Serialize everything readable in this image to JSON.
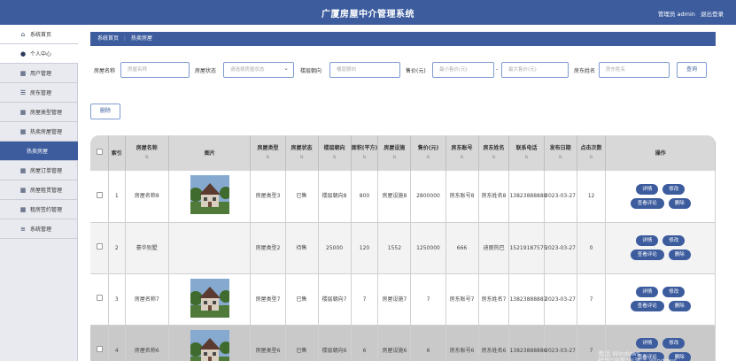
{
  "header": {
    "title": "广厦房屋中介管理系统",
    "user_label": "管理员 admin",
    "logout_label": "退出登录"
  },
  "sidebar": {
    "items": [
      {
        "label": "系统首页",
        "icon": "home-icon"
      },
      {
        "label": "个人中心",
        "icon": "user-icon"
      },
      {
        "label": "用户管理",
        "icon": "grid-icon"
      },
      {
        "label": "房东管理",
        "icon": "list-icon"
      },
      {
        "label": "房屋类型管理",
        "icon": "grid-icon"
      },
      {
        "label": "热卖房屋管理",
        "icon": "grid-icon"
      },
      {
        "label": "热卖房屋",
        "icon": ""
      },
      {
        "label": "房屋订单管理",
        "icon": "grid-icon"
      },
      {
        "label": "房屋租赁管理",
        "icon": "grid-icon"
      },
      {
        "label": "租房签约管理",
        "icon": "grid-icon"
      },
      {
        "label": "系统管理",
        "icon": "menu-icon"
      }
    ]
  },
  "breadcrumb": {
    "home": "系统首页",
    "separator": "⋮",
    "current": "热卖房屋"
  },
  "search": {
    "name_label": "房屋名称",
    "name_placeholder": "房屋名称",
    "status_label": "房屋状态",
    "status_placeholder": "请选择房屋状态",
    "orientation_label": "楼层朝向",
    "orientation_placeholder": "楼层朝向",
    "price_label": "售价(元)",
    "min_price_placeholder": "最小售价(元)",
    "range_separator": "-",
    "max_price_placeholder": "最大售价(元)",
    "landlord_label": "房东姓名",
    "landlord_placeholder": "房东姓名",
    "query_button": "查询"
  },
  "toolbar": {
    "delete_button": "删除"
  },
  "table": {
    "headers": [
      "索引",
      "房屋名称",
      "图片",
      "房屋类型",
      "房屋状态",
      "楼层朝向",
      "面积(平方)",
      "房屋设施",
      "售价(元)",
      "房东账号",
      "房东姓名",
      "联系电话",
      "发布日期",
      "点击次数",
      "操作"
    ],
    "rows": [
      {
        "index": "1",
        "name": "房屋名称8",
        "image": "house-photo",
        "type": "房屋类型3",
        "status": "已售",
        "orientation": "楼层朝向8",
        "area": "800",
        "facility": "房屋设施8",
        "price": "2800000",
        "account": "房东账号8",
        "landlord": "房东姓名8",
        "phone": "13823888888",
        "date": "2023-03-27",
        "clicks": "12"
      },
      {
        "index": "2",
        "name": "豪华别墅",
        "image": "",
        "type": "房屋类型2",
        "status": "待售",
        "orientation": "25000",
        "area": "120",
        "facility": "1552",
        "price": "1250000",
        "account": "666",
        "landlord": "迪丽热巴",
        "phone": "15219187575",
        "date": "2023-03-27",
        "clicks": "0"
      },
      {
        "index": "3",
        "name": "房屋名称7",
        "image": "house-photo",
        "type": "房屋类型7",
        "status": "已售",
        "orientation": "楼层朝向7",
        "area": "7",
        "facility": "房屋设施7",
        "price": "7",
        "account": "房东账号7",
        "landlord": "房东姓名7",
        "phone": "13823888887",
        "date": "2023-03-27",
        "clicks": "7"
      },
      {
        "index": "4",
        "name": "房屋名称6",
        "image": "house-photo",
        "type": "房屋类型6",
        "status": "已售",
        "orientation": "楼层朝向6",
        "area": "6",
        "facility": "房屋设施6",
        "price": "6",
        "account": "房东账号6",
        "landlord": "房东姓名6",
        "phone": "13823888886",
        "date": "2023-03-27",
        "clicks": "7"
      }
    ],
    "actions": {
      "detail": "详情",
      "edit": "修改",
      "view_comments": "查看评论",
      "delete": "删除"
    }
  },
  "colors": {
    "primary": "#3c5c9e",
    "sidebar_bg": "#e8eaef"
  }
}
